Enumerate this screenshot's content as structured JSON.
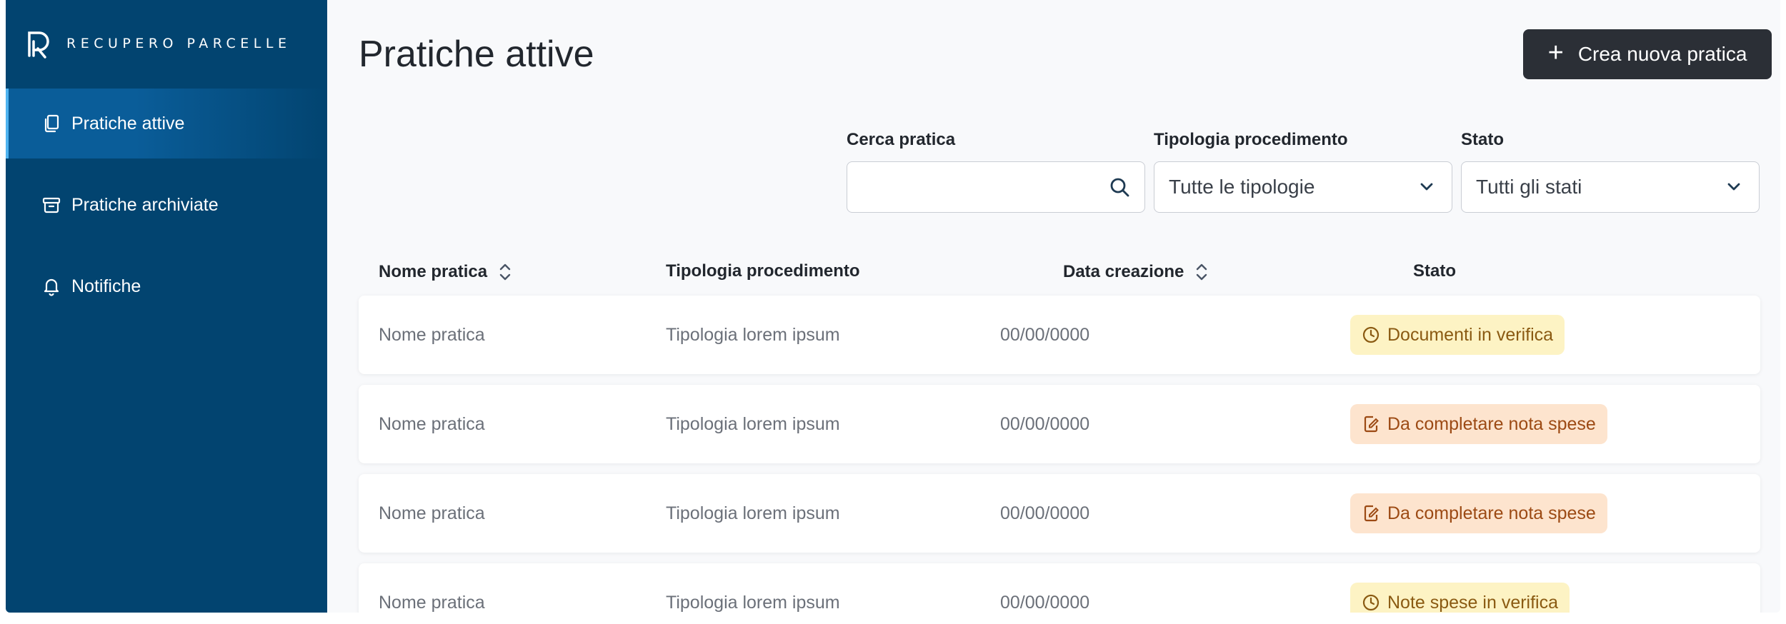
{
  "brand": {
    "name": "RECUPERO PARCELLE"
  },
  "sidebar": {
    "items": [
      {
        "label": "Pratiche attive",
        "icon": "files-icon",
        "active": true
      },
      {
        "label": "Pratiche archiviate",
        "icon": "archive-icon",
        "active": false
      },
      {
        "label": "Notifiche",
        "icon": "bell-icon",
        "active": false
      }
    ]
  },
  "header": {
    "title": "Pratiche attive",
    "create_label": "Crea nuova pratica"
  },
  "filters": {
    "search": {
      "label": "Cerca pratica",
      "value": "",
      "placeholder": ""
    },
    "tipologia": {
      "label": "Tipologia procedimento",
      "value": "Tutte le tipologie"
    },
    "stato": {
      "label": "Stato",
      "value": "Tutti gli stati"
    }
  },
  "table": {
    "columns": [
      "Nome pratica",
      "Tipologia procedimento",
      "Data creazione",
      "Stato"
    ],
    "rows": [
      {
        "nome": "Nome pratica",
        "tipologia": "Tipologia lorem ipsum",
        "data": "00/00/0000",
        "stato": "Documenti in verifica",
        "stato_color": "#fdf3c4",
        "stato_icon": "clock-icon"
      },
      {
        "nome": "Nome pratica",
        "tipologia": "Tipologia lorem ipsum",
        "data": "00/00/0000",
        "stato": "Da completare nota spese",
        "stato_color": "#fde4ce",
        "stato_icon": "edit-document-icon"
      },
      {
        "nome": "Nome pratica",
        "tipologia": "Tipologia lorem ipsum",
        "data": "00/00/0000",
        "stato": "Da completare nota spese",
        "stato_color": "#fde4ce",
        "stato_icon": "edit-document-icon"
      },
      {
        "nome": "Nome pratica",
        "tipologia": "Tipologia lorem ipsum",
        "data": "00/00/0000",
        "stato": "Note spese in verifica",
        "stato_color": "#fdf3c4",
        "stato_icon": "clock-icon"
      }
    ]
  },
  "colors": {
    "sidebar": "#024470",
    "accent": "#4fb3f0",
    "button": "#2b2f36"
  }
}
